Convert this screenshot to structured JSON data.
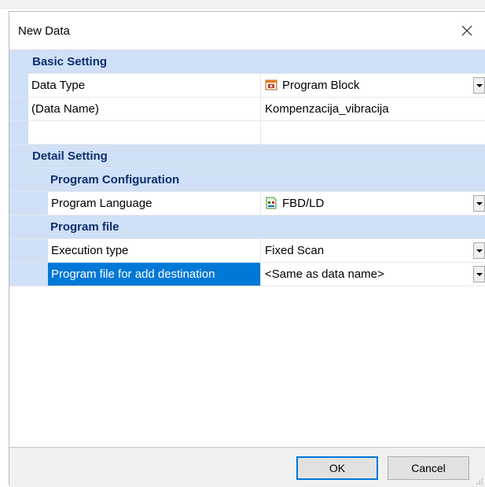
{
  "dialog": {
    "title": "New Data"
  },
  "sections": {
    "basic": {
      "label": "Basic Setting",
      "data_type": {
        "name": "Data Type",
        "value": "Program Block",
        "icon": "program-block-icon"
      },
      "data_name": {
        "name": "(Data Name)",
        "value": "Kompenzacija_vibracija"
      }
    },
    "detail": {
      "label": "Detail Setting",
      "program_configuration": {
        "label": "Program Configuration",
        "language": {
          "name": "Program Language",
          "value": "FBD/LD",
          "icon": "fbd-ld-icon"
        }
      },
      "program_file": {
        "label": "Program file",
        "execution_type": {
          "name": "Execution type",
          "value": "Fixed Scan"
        },
        "destination": {
          "name": "Program file for add destination",
          "value": "<Same as data name>"
        }
      }
    }
  },
  "buttons": {
    "ok": "OK",
    "cancel": "Cancel"
  },
  "colors": {
    "category_bg": "#cfe0f7",
    "category_text": "#0f2f6e",
    "selection": "#0078d7"
  }
}
